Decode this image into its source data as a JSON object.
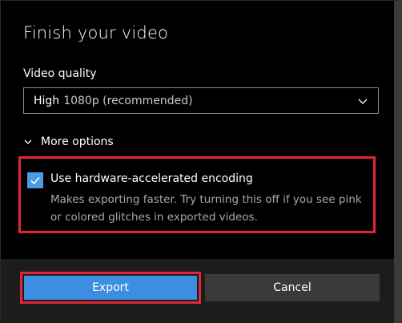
{
  "dialog": {
    "title": "Finish your video"
  },
  "quality": {
    "label": "Video quality",
    "selected_bold": "High",
    "selected_rest": "1080p (recommended)"
  },
  "more_options": {
    "label": "More options"
  },
  "hardware": {
    "checked": true,
    "label": "Use hardware-accelerated encoding",
    "description": "Makes exporting faster. Try turning this off if you see pink or colored glitches in exported videos."
  },
  "buttons": {
    "export": "Export",
    "cancel": "Cancel"
  },
  "colors": {
    "accent": "#3d8ee0",
    "checkbox": "#4a9be0",
    "highlight": "#e32636",
    "background": "#000000"
  },
  "icons": {
    "dropdown": "chevron-down-icon",
    "expander": "chevron-down-icon",
    "check": "checkmark-icon"
  }
}
